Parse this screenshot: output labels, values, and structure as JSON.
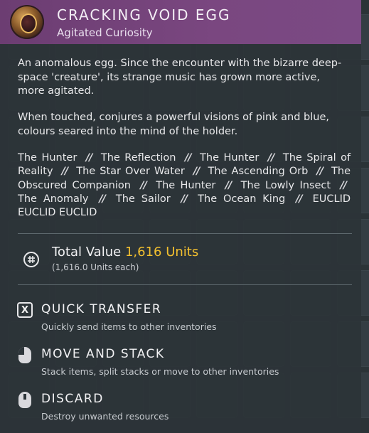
{
  "item": {
    "title": "CRACKING VOID EGG",
    "subtitle": "Agitated Curiosity",
    "icon": "void-egg-icon"
  },
  "description": [
    "An anomalous egg. Since the encounter with the bizarre deep-space 'creature', its strange music has grown more active, more agitated.",
    "When touched, conjures a powerful visions of pink and blue, colours seared into the mind of the holder."
  ],
  "songs": [
    "The Hunter",
    "The Reflection",
    "The Hunter",
    "The Spiral of Reality",
    "The Star Over Water",
    "The Ascending Orb",
    "The Obscured Companion",
    "The Hunter",
    "The Lowly Insect",
    "The Anomaly",
    "The Sailor",
    "The Ocean King",
    "EUCLID EUCLID EUCLID"
  ],
  "song_separator": "//",
  "value": {
    "label": "Total Value",
    "amount": "1,616 Units",
    "each": "(1,616.0 Units each)",
    "icon": "units-icon",
    "amount_color": "#f2bf2f"
  },
  "actions": [
    {
      "key": "X",
      "title": "QUICK TRANSFER",
      "desc": "Quickly send items to other inventories",
      "icon": "x-key-icon"
    },
    {
      "title": "MOVE AND STACK",
      "desc": "Stack items, split stacks or move to other inventories",
      "icon": "left-mouse-icon"
    },
    {
      "title": "DISCARD",
      "desc": "Destroy unwanted resources",
      "icon": "middle-mouse-icon"
    }
  ],
  "colors": {
    "header": "#7a4780",
    "panel": "#2c3438",
    "accent_gold": "#f2bf2f"
  }
}
